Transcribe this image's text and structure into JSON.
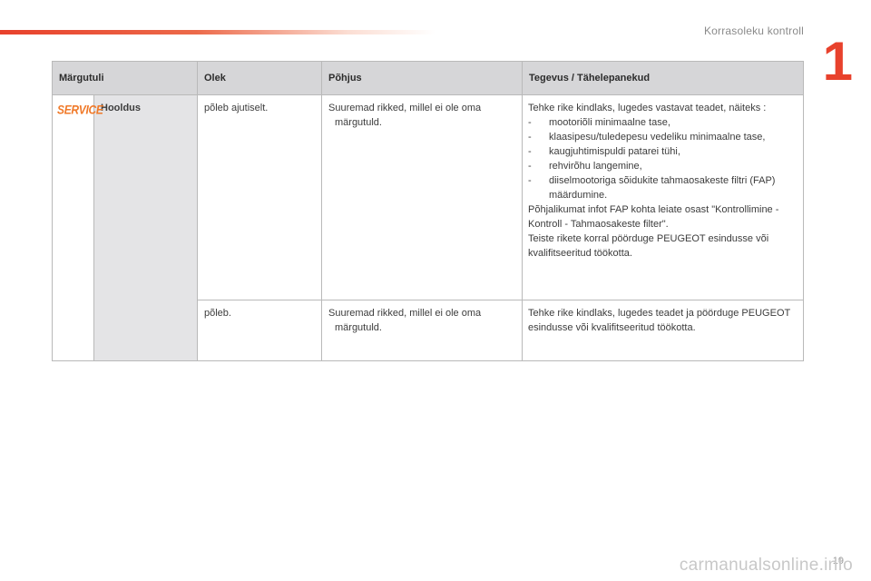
{
  "header": {
    "chapter_title": "Korrasoleku kontroll",
    "chapter_number": "1",
    "accent_color": "#e8412c"
  },
  "table": {
    "columns": [
      "Märgutuli",
      "Olek",
      "Põhjus",
      "Tegevus / Tähelepanekud"
    ],
    "indicator": {
      "icon_text": "SERVICE",
      "icon_color": "#f07a2a",
      "name": "Hooldus"
    },
    "rows": [
      {
        "state": "põleb ajutiselt.",
        "cause_line1": "Suuremad rikked, millel ei ole oma",
        "cause_line2": "märgutuld.",
        "action_intro": "Tehke rike kindlaks, lugedes vastavat teadet, näiteks :",
        "action_items": [
          "mootoriõli minimaalne tase,",
          "klaasipesu/tuledepesu vedeliku minimaalne tase,",
          "kaugjuhtimispuldi patarei tühi,",
          "rehvirõhu langemine,",
          "diiselmootoriga sõidukite tahmaosakeste filtri (FAP) määrdumine."
        ],
        "action_note1": "Põhjalikumat infot FAP kohta leiate osast \"Kontrollimine - Kontroll - Tahmaosakeste filter\".",
        "action_note2": "Teiste rikete korral pöörduge PEUGEOT esindusse või kvalifitseeritud töökotta."
      },
      {
        "state": "põleb.",
        "cause_line1": "Suuremad rikked, millel ei ole oma",
        "cause_line2": "märgutuld.",
        "action_text": "Tehke rike kindlaks, lugedes teadet ja pöörduge PEUGEOT esindusse või kvalifitseeritud töökotta."
      }
    ]
  },
  "footer": {
    "page_number": "19",
    "watermark": "carmanualsonline.info"
  }
}
